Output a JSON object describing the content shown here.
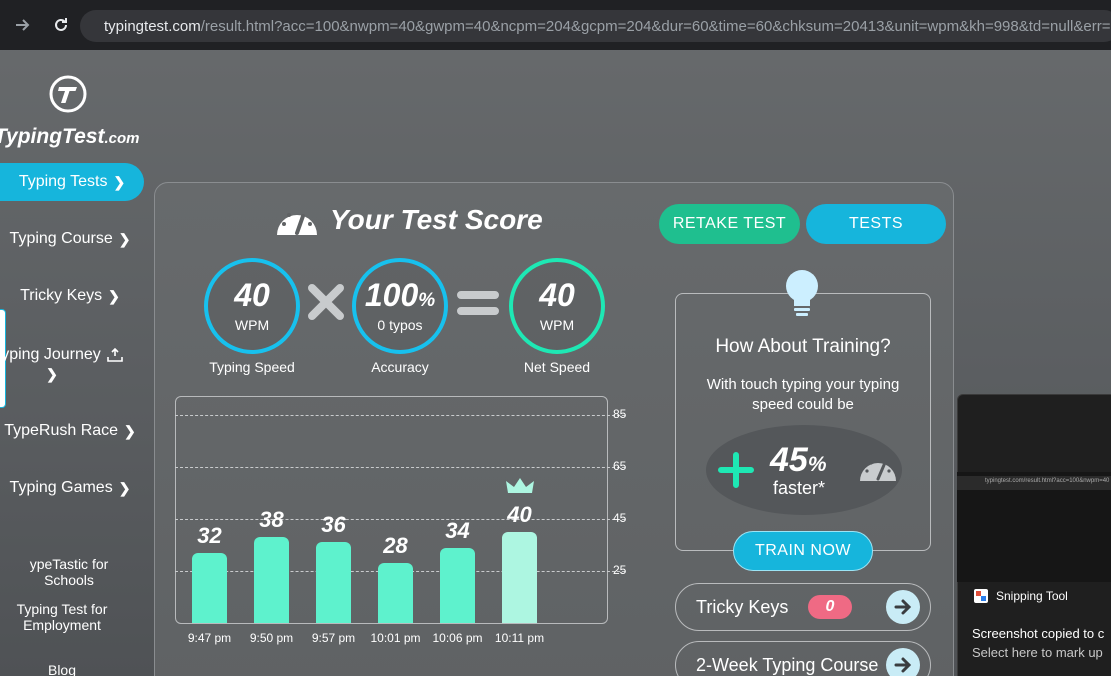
{
  "browser": {
    "url_host": "typingtest.com",
    "url_path": "/result.html?acc=100&nwpm=40&gwpm=40&ncpm=204&gcpm=204&dur=60&time=60&chksum=20413&unit=wpm&kh=998&td=null&err=0&"
  },
  "logo": {
    "text": "TypingTest",
    "suffix": ".com"
  },
  "sidebar": {
    "items": [
      {
        "label": "Typing Tests"
      },
      {
        "label": "Typing Course"
      },
      {
        "label": "Tricky Keys"
      },
      {
        "label": "yping Journey"
      },
      {
        "label": "TypeRush Race"
      },
      {
        "label": "Typing Games"
      }
    ],
    "small_links": [
      "ypeTastic for Schools",
      "Typing Test for Employment",
      "Blog"
    ]
  },
  "result": {
    "title": "Your Test Score",
    "retake_label": "RETAKE TEST",
    "tests_label": "TESTS",
    "typing_speed": {
      "value": "40",
      "unit": "WPM",
      "caption": "Typing Speed"
    },
    "accuracy": {
      "value": "100",
      "unit": "%",
      "sub": "0  typos",
      "caption": "Accuracy"
    },
    "net_speed": {
      "value": "40",
      "unit": "WPM",
      "caption": "Net Speed"
    }
  },
  "chart_data": {
    "type": "bar",
    "categories": [
      "9:47 pm",
      "9:50 pm",
      "9:57 pm",
      "10:01 pm",
      "10:06 pm",
      "10:11 pm"
    ],
    "values": [
      32,
      38,
      36,
      28,
      34,
      40
    ],
    "yticks": [
      25,
      45,
      65,
      85
    ],
    "ylim": [
      5,
      85
    ],
    "grid": true,
    "highlight_last": true,
    "colors": {
      "bar": "#5ef2cd",
      "last_bar": "#adf6e1"
    }
  },
  "training": {
    "title": "How About Training?",
    "desc": "With touch typing your typing speed could be",
    "pct": "45",
    "pct_unit": "%",
    "faster": "faster*",
    "button": "TRAIN NOW"
  },
  "links": [
    {
      "label": "Tricky Keys",
      "badge": "0"
    },
    {
      "label": "2-Week Typing Course"
    }
  ],
  "snipping": {
    "app": "Snipping Tool",
    "message": "Screenshot copied to c",
    "sub": "Select here to mark up",
    "mini_url": "typingtest.com/result.html?acc=100&nwpm=40"
  },
  "colors": {
    "accent_blue": "#16b5dc",
    "accent_green": "#1fbf8f",
    "ring_blue": "#17c1ee",
    "ring_green": "#1ee8b4",
    "badge_pink": "#ef6a84"
  }
}
